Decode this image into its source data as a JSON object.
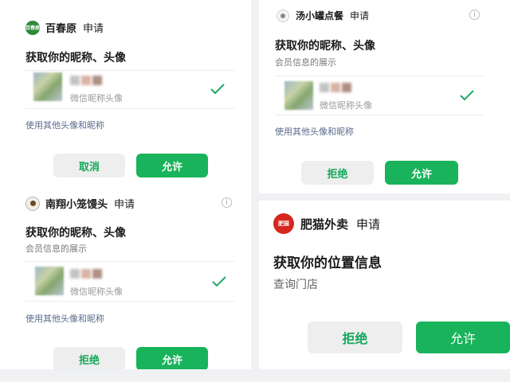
{
  "colors": {
    "accent_green": "#18b35a",
    "secondary_button_bg": "#eeeeee",
    "link_blue": "#5a6b8c"
  },
  "panel_a": {
    "app_logo_text": "百春原",
    "app_name": "百春原",
    "request": "申请",
    "title": "获取你的昵称、头像",
    "avatar_hint": "微信昵称头像",
    "other_link": "使用其他头像和昵称",
    "cancel_label": "取消",
    "allow_label": "允许"
  },
  "panel_b": {
    "app_name": "南翔小笼馒头",
    "request": "申请",
    "title": "获取你的昵称、头像",
    "subtitle": "会员信息的展示",
    "avatar_hint": "微信昵称头像",
    "other_link": "使用其他头像和昵称",
    "reject_label": "拒绝",
    "allow_label": "允许",
    "info_icon": "i"
  },
  "panel_c": {
    "app_name": "汤小罐点餐",
    "request": "申请",
    "title": "获取你的昵称、头像",
    "subtitle": "会员信息的展示",
    "avatar_hint": "微信昵称头像",
    "other_link": "使用其他头像和昵称",
    "reject_label": "拒绝",
    "allow_label": "允许",
    "info_icon": "i"
  },
  "panel_d": {
    "app_logo_text": "肥猫",
    "app_name": "肥猫外卖",
    "request": "申请",
    "title": "获取你的位置信息",
    "subtitle": "查询门店",
    "reject_label": "拒绝",
    "allow_label": "允许"
  }
}
